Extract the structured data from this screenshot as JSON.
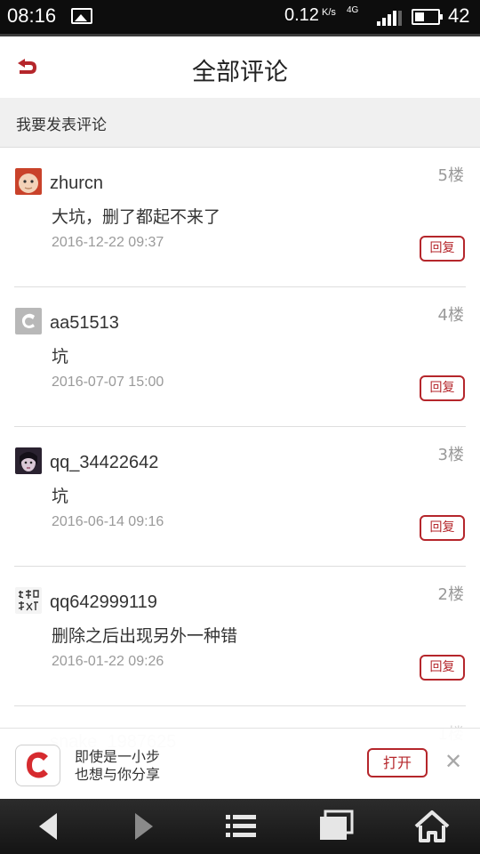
{
  "status_bar": {
    "time": "08:16",
    "speed": "0.12",
    "speed_unit": "K/s",
    "network": "4G",
    "battery_percent": "42",
    "signal_level": 4,
    "icons": [
      "image-icon",
      "signal-icon",
      "battery-icon"
    ]
  },
  "header": {
    "title": "全部评论",
    "back_icon": "back-arrow-icon"
  },
  "post_comment": {
    "label": "我要发表评论"
  },
  "comments": [
    {
      "user": "zhurcn",
      "floor": "5楼",
      "text": "大坑，删了都起不来了",
      "date": "2016-12-22 09:37",
      "reply_label": "回复"
    },
    {
      "user": "aa51513",
      "floor": "4楼",
      "text": "坑",
      "date": "2016-07-07 15:00",
      "reply_label": "回复"
    },
    {
      "user": "qq_34422642",
      "floor": "3楼",
      "text": "坑",
      "date": "2016-06-14 09:16",
      "reply_label": "回复"
    },
    {
      "user": "qq642999119",
      "floor": "2楼",
      "text": "删除之后出现另外一种错",
      "date": "2016-01-22 09:26",
      "reply_label": "回复"
    }
  ],
  "partial_comment": {
    "user": "snake_1987625",
    "floor": "1楼"
  },
  "banner": {
    "line1": "即使是一小步",
    "line2": "也想与你分享",
    "open_label": "打开",
    "close_icon": "close-icon"
  },
  "colors": {
    "accent": "#b5262b",
    "status_bar_bg": "#0d0d0d",
    "nav_bar_bg": "#1c1c1c"
  },
  "nav_bar": {
    "icons": [
      "back-triangle-icon",
      "forward-triangle-icon",
      "menu-list-icon",
      "windows-icon",
      "home-icon"
    ]
  }
}
